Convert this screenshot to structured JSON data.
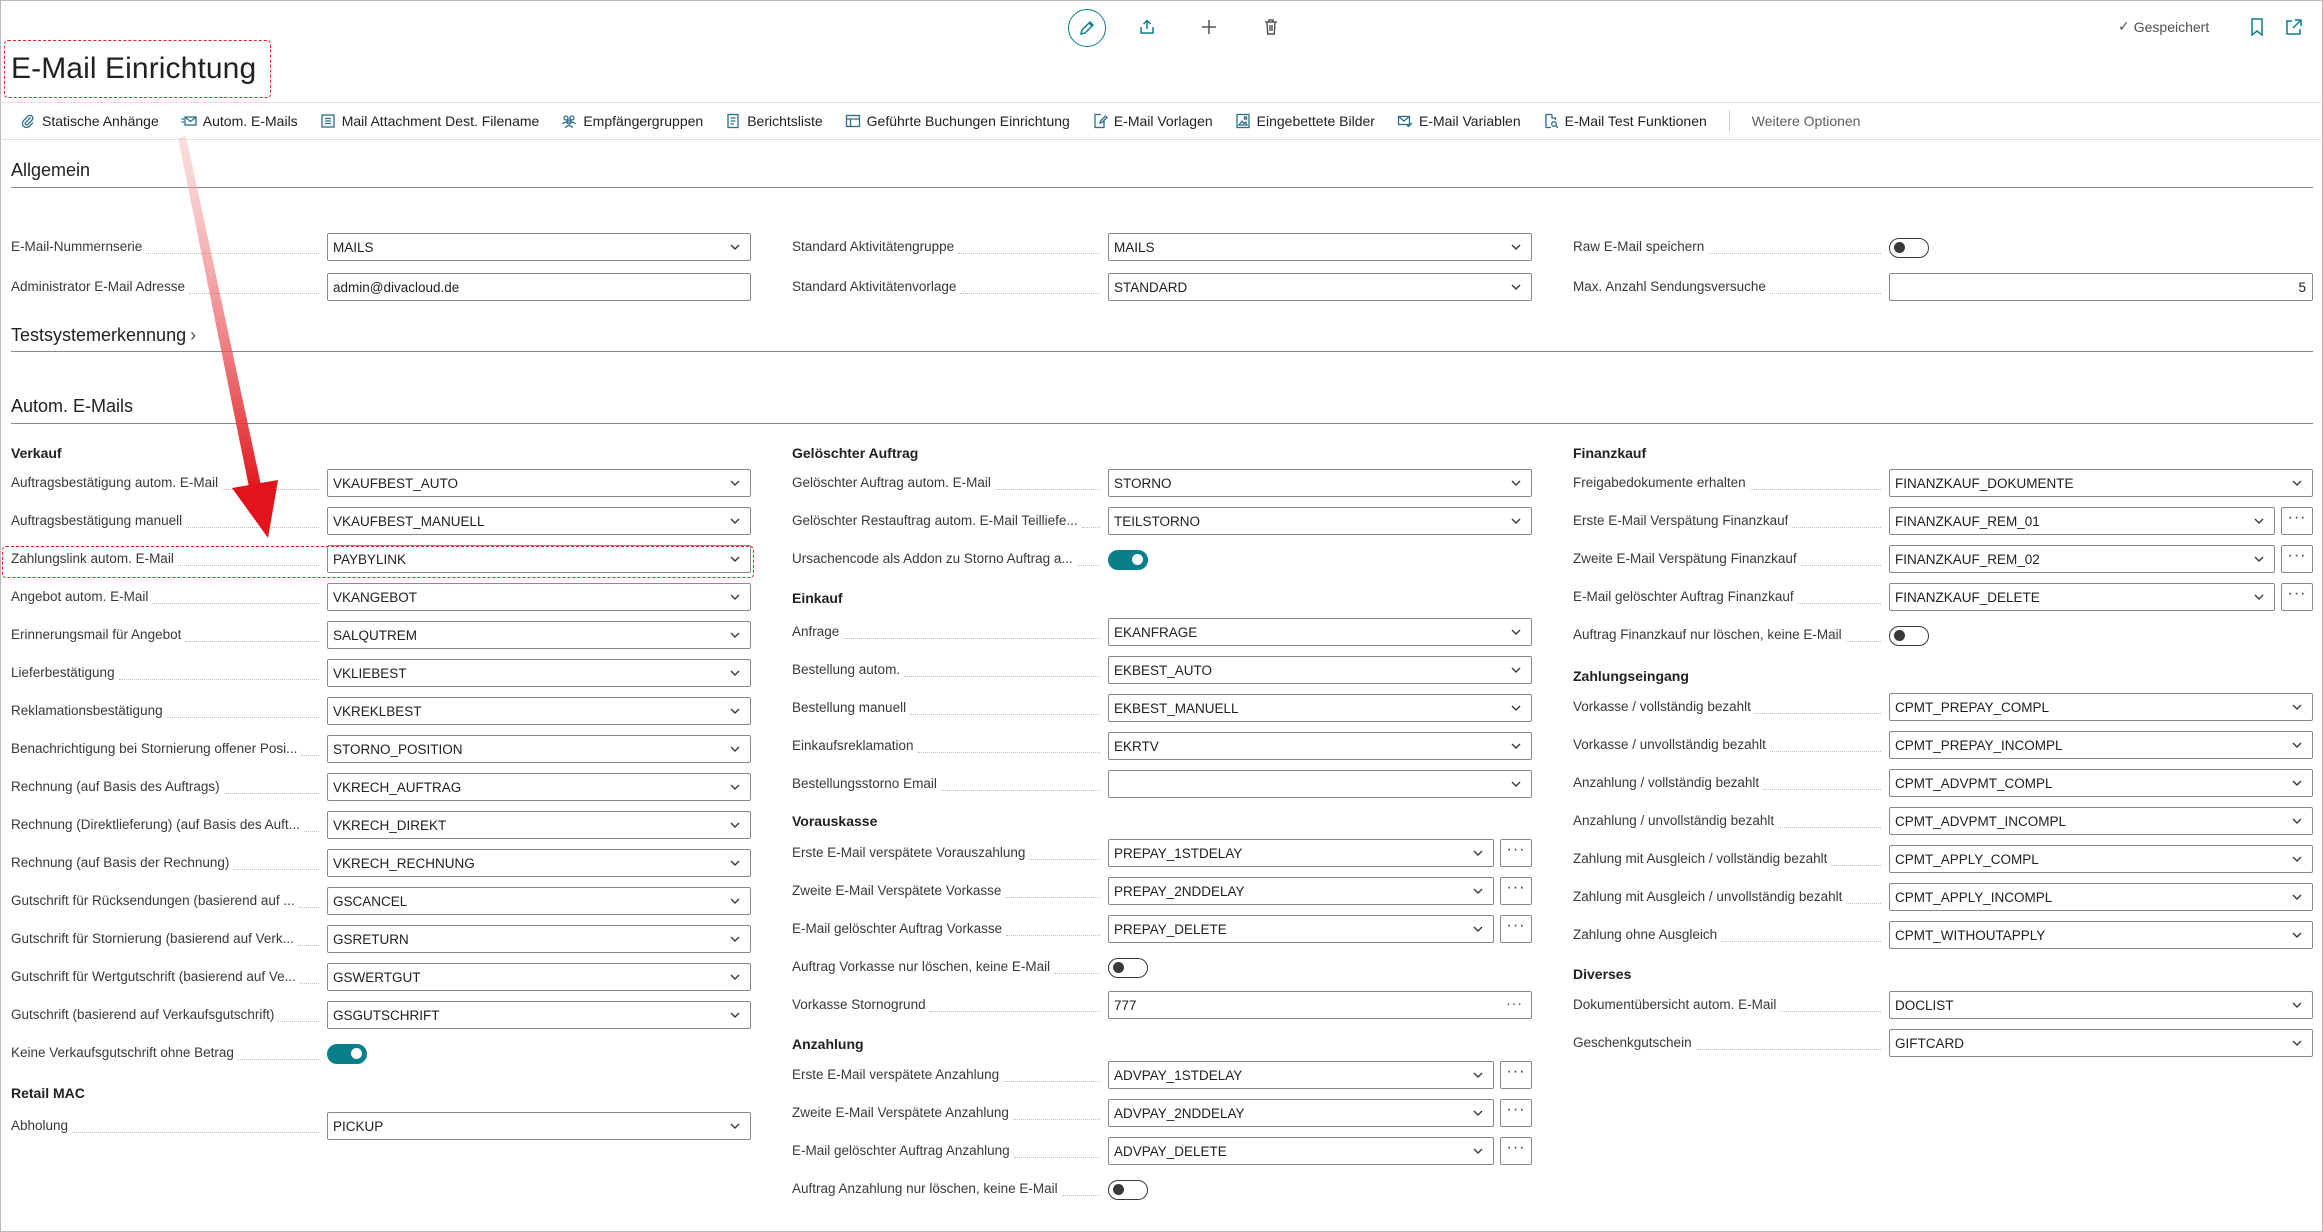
{
  "header": {
    "title": "E-Mail Einrichtung",
    "saved_label": "Gespeichert",
    "icons": [
      "edit-icon",
      "share-icon",
      "add-icon",
      "delete-icon",
      "bookmark-icon",
      "popout-icon"
    ]
  },
  "toolbar": {
    "items": [
      {
        "label": "Statische Anhänge",
        "icon": "paperclip-icon"
      },
      {
        "label": "Autom. E-Mails",
        "icon": "mail-send-icon"
      },
      {
        "label": "Mail Attachment Dest. Filename",
        "icon": "list-icon"
      },
      {
        "label": "Empfängergruppen",
        "icon": "people-icon"
      },
      {
        "label": "Berichtsliste",
        "icon": "report-icon"
      },
      {
        "label": "Geführte Buchungen Einrichtung",
        "icon": "table-icon"
      },
      {
        "label": "E-Mail Vorlagen",
        "icon": "doc-edit-icon"
      },
      {
        "label": "Eingebettete Bilder",
        "icon": "image-icon"
      },
      {
        "label": "E-Mail Variablen",
        "icon": "mail-check-icon"
      },
      {
        "label": "E-Mail Test Funktionen",
        "icon": "doc-search-icon"
      }
    ],
    "more_label": "Weitere Optionen"
  },
  "sections": {
    "allgemein": "Allgemein",
    "testsystem": "Testsystemerkennung",
    "autom": "Autom. E-Mails"
  },
  "allgemein": {
    "col1": [
      {
        "label": "E-Mail-Nummernserie",
        "value": "MAILS",
        "kind": "select"
      },
      {
        "label": "Administrator E-Mail Adresse",
        "value": "admin@divacloud.de",
        "kind": "text"
      }
    ],
    "col2": [
      {
        "label": "Standard Aktivitätengruppe",
        "value": "MAILS",
        "kind": "select"
      },
      {
        "label": "Standard Aktivitätenvorlage",
        "value": "STANDARD",
        "kind": "select"
      }
    ],
    "col3": [
      {
        "label": "Raw E-Mail speichern",
        "kind": "toggle",
        "on": false
      },
      {
        "label": "Max. Anzahl Sendungsversuche",
        "value": "5",
        "kind": "number"
      }
    ]
  },
  "groups": {
    "verkauf": "Verkauf",
    "retail": "Retail MAC",
    "geloescht": "Gelöschter Auftrag",
    "einkauf": "Einkauf",
    "vorauskasse": "Vorauskasse",
    "anzahlung": "Anzahlung",
    "finanzkauf": "Finanzkauf",
    "zahlungseingang": "Zahlungseingang",
    "diverses": "Diverses"
  },
  "verkauf": [
    {
      "label": "Auftragsbestätigung autom. E-Mail",
      "value": "VKAUFBEST_AUTO",
      "kind": "select"
    },
    {
      "label": "Auftragsbestätigung manuell",
      "value": "VKAUFBEST_MANUELL",
      "kind": "select"
    },
    {
      "label": "Zahlungslink autom. E-Mail",
      "value": "PAYBYLINK",
      "kind": "select"
    },
    {
      "label": "Angebot autom. E-Mail",
      "value": "VKANGEBOT",
      "kind": "select"
    },
    {
      "label": "Erinnerungsmail für Angebot",
      "value": "SALQUTREM",
      "kind": "select"
    },
    {
      "label": "Lieferbestätigung",
      "value": "VKLIEBEST",
      "kind": "select"
    },
    {
      "label": "Reklamationsbestätigung",
      "value": "VKREKLBEST",
      "kind": "select"
    },
    {
      "label": "Benachrichtigung bei Stornierung offener Posi...",
      "value": "STORNO_POSITION",
      "kind": "select"
    },
    {
      "label": "Rechnung (auf Basis des Auftrags)",
      "value": "VKRECH_AUFTRAG",
      "kind": "select"
    },
    {
      "label": "Rechnung (Direktlieferung) (auf Basis des Auft...",
      "value": "VKRECH_DIREKT",
      "kind": "select"
    },
    {
      "label": "Rechnung (auf Basis der Rechnung)",
      "value": "VKRECH_RECHNUNG",
      "kind": "select"
    },
    {
      "label": "Gutschrift für Rücksendungen (basierend auf ...",
      "value": "GSCANCEL",
      "kind": "select"
    },
    {
      "label": "Gutschrift für Stornierung (basierend auf Verk...",
      "value": "GSRETURN",
      "kind": "select"
    },
    {
      "label": "Gutschrift für Wertgutschrift (basierend auf Ve...",
      "value": "GSWERTGUT",
      "kind": "select"
    },
    {
      "label": "Gutschrift (basierend auf Verkaufsgutschrift)",
      "value": "GSGUTSCHRIFT",
      "kind": "select"
    },
    {
      "label": "Keine Verkaufsgutschrift ohne Betrag",
      "kind": "toggle",
      "on": true
    }
  ],
  "retail": [
    {
      "label": "Abholung",
      "value": "PICKUP",
      "kind": "select"
    }
  ],
  "geloescht": [
    {
      "label": "Gelöschter Auftrag autom. E-Mail",
      "value": "STORNO",
      "kind": "select"
    },
    {
      "label": "Gelöschter Restauftrag autom. E-Mail Teilliefe...",
      "value": "TEILSTORNO",
      "kind": "select"
    },
    {
      "label": "Ursachencode als Addon zu Storno Auftrag a...",
      "kind": "toggle",
      "on": true
    }
  ],
  "einkauf": [
    {
      "label": "Anfrage",
      "value": "EKANFRAGE",
      "kind": "select"
    },
    {
      "label": "Bestellung autom.",
      "value": "EKBEST_AUTO",
      "kind": "select"
    },
    {
      "label": "Bestellung manuell",
      "value": "EKBEST_MANUELL",
      "kind": "select"
    },
    {
      "label": "Einkaufsreklamation",
      "value": "EKRTV",
      "kind": "select"
    },
    {
      "label": "Bestellungsstorno Email",
      "value": "",
      "kind": "select"
    }
  ],
  "vorauskasse": [
    {
      "label": "Erste E-Mail verspätete Vorauszahlung",
      "value": "PREPAY_1STDELAY",
      "kind": "select-btn"
    },
    {
      "label": "Zweite E-Mail Verspätete Vorkasse",
      "value": "PREPAY_2NDDELAY",
      "kind": "select-btn"
    },
    {
      "label": "E-Mail gelöschter Auftrag Vorkasse",
      "value": "PREPAY_DELETE",
      "kind": "select-btn"
    },
    {
      "label": "Auftrag Vorkasse nur löschen, keine E-Mail",
      "kind": "toggle",
      "on": false
    },
    {
      "label": "Vorkasse Stornogrund",
      "value": "777",
      "kind": "lookup"
    }
  ],
  "anzahlung": [
    {
      "label": "Erste E-Mail verspätete Anzahlung",
      "value": "ADVPAY_1STDELAY",
      "kind": "select-btn"
    },
    {
      "label": "Zweite E-Mail Verspätete Anzahlung",
      "value": "ADVPAY_2NDDELAY",
      "kind": "select-btn"
    },
    {
      "label": "E-Mail gelöschter Auftrag Anzahlung",
      "value": "ADVPAY_DELETE",
      "kind": "select-btn"
    },
    {
      "label": "Auftrag Anzahlung nur löschen, keine E-Mail",
      "kind": "toggle",
      "on": false
    }
  ],
  "finanzkauf": [
    {
      "label": "Freigabedokumente erhalten",
      "value": "FINANZKAUF_DOKUMENTE",
      "kind": "select"
    },
    {
      "label": "Erste E-Mail Verspätung Finanzkauf",
      "value": "FINANZKAUF_REM_01",
      "kind": "select-btn"
    },
    {
      "label": "Zweite E-Mail Verspätung Finanzkauf",
      "value": "FINANZKAUF_REM_02",
      "kind": "select-btn"
    },
    {
      "label": "E-Mail gelöschter Auftrag Finanzkauf",
      "value": "FINANZKAUF_DELETE",
      "kind": "select-btn"
    },
    {
      "label": "Auftrag Finanzkauf nur löschen, keine E-Mail",
      "kind": "toggle",
      "on": false
    }
  ],
  "zahlungseingang": [
    {
      "label": "Vorkasse / vollständig bezahlt",
      "value": "CPMT_PREPAY_COMPL",
      "kind": "select"
    },
    {
      "label": "Vorkasse / unvollständig bezahlt",
      "value": "CPMT_PREPAY_INCOMPL",
      "kind": "select"
    },
    {
      "label": "Anzahlung / vollständig bezahlt",
      "value": "CPMT_ADVPMT_COMPL",
      "kind": "select"
    },
    {
      "label": "Anzahlung / unvollständig bezahlt",
      "value": "CPMT_ADVPMT_INCOMPL",
      "kind": "select"
    },
    {
      "label": "Zahlung mit Ausgleich / vollständig bezahlt",
      "value": "CPMT_APPLY_COMPL",
      "kind": "select"
    },
    {
      "label": "Zahlung mit Ausgleich / unvollständig bezahlt",
      "value": "CPMT_APPLY_INCOMPL",
      "kind": "select"
    },
    {
      "label": "Zahlung ohne Ausgleich",
      "value": "CPMT_WITHOUTAPPLY",
      "kind": "select"
    }
  ],
  "diverses": [
    {
      "label": "Dokumentübersicht autom. E-Mail",
      "value": "DOCLIST",
      "kind": "select"
    },
    {
      "label": "Geschenkgutschein",
      "value": "GIFTCARD",
      "kind": "select"
    }
  ],
  "colors": {
    "accent": "#0a7f8c",
    "highlight": "#e0262a"
  }
}
